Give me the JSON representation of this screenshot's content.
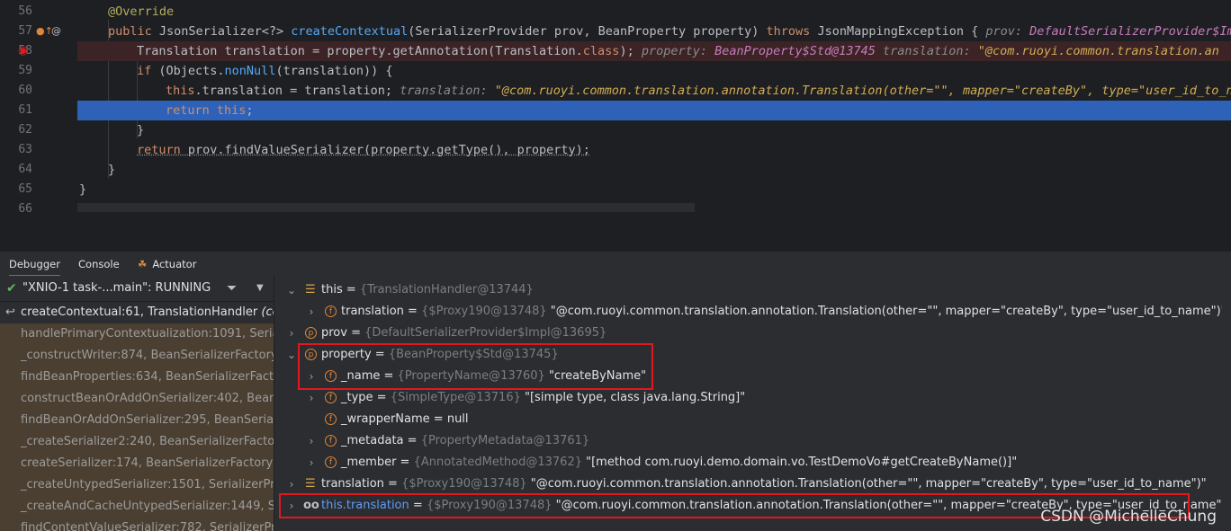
{
  "editor": {
    "lines": [
      {
        "no": "56",
        "tokens": [
          {
            "c": "ann",
            "t": "@Override"
          }
        ]
      },
      {
        "no": "57",
        "tokens": [
          {
            "c": "kw",
            "t": "public "
          },
          {
            "c": "ty",
            "t": "JsonSerializer<?> "
          },
          {
            "c": "fn",
            "t": "createContextual"
          },
          {
            "c": "ty",
            "t": "(SerializerProvider prov, BeanProperty property) "
          },
          {
            "c": "kw",
            "t": "throws "
          },
          {
            "c": "ty",
            "t": "JsonMappingException {   "
          },
          {
            "c": "hint",
            "t": "prov: "
          },
          {
            "c": "hintv",
            "t": "DefaultSerializerProvider$Impl"
          }
        ]
      },
      {
        "no": "58",
        "tokens": [
          {
            "c": "ty",
            "t": "Translation translation = property.getAnnotation(Translation."
          },
          {
            "c": "kw",
            "t": "class"
          },
          {
            "c": "ty",
            "t": ");   "
          },
          {
            "c": "hint",
            "t": "property: "
          },
          {
            "c": "hintv",
            "t": "BeanProperty$Std@13745    "
          },
          {
            "c": "hint",
            "t": "translation: "
          },
          {
            "c": "hintstr",
            "t": "\"@com.ruoyi.common.translation.an"
          }
        ]
      },
      {
        "no": "59",
        "tokens": [
          {
            "c": "kw",
            "t": "if "
          },
          {
            "c": "ty",
            "t": "(Objects."
          },
          {
            "c": "fn",
            "t": "nonNull"
          },
          {
            "c": "ty",
            "t": "(translation)) {"
          }
        ]
      },
      {
        "no": "60",
        "tokens": [
          {
            "c": "kw",
            "t": "this"
          },
          {
            "c": "ty",
            "t": ".translation = translation;   "
          },
          {
            "c": "hint",
            "t": "translation: "
          },
          {
            "c": "hintstr",
            "t": "\"@com.ruoyi.common.translation.annotation.Translation(other=\"\", mapper=\"createBy\", type=\"user_id_to_na"
          }
        ]
      },
      {
        "no": "61",
        "tokens": [
          {
            "c": "kw",
            "t": "return "
          },
          {
            "c": "kw",
            "t": "this"
          },
          {
            "c": "ty",
            "t": ";"
          }
        ]
      },
      {
        "no": "62",
        "tokens": [
          {
            "c": "ty",
            "t": "}"
          }
        ]
      },
      {
        "no": "63",
        "tokens": [
          {
            "c": "kw",
            "t": "return "
          },
          {
            "c": "ty",
            "t": "prov.findValueSerializer(property.getType(), property);"
          }
        ]
      },
      {
        "no": "64",
        "tokens": [
          {
            "c": "ty",
            "t": "}"
          }
        ]
      },
      {
        "no": "65",
        "tokens": [
          {
            "c": "ty",
            "t": "}"
          }
        ]
      },
      {
        "no": "66",
        "tokens": []
      }
    ]
  },
  "tabs": {
    "debugger": "Debugger",
    "console": "Console",
    "actuator": "Actuator"
  },
  "thread": {
    "label": "\"XNIO-1 task-...main\": RUNNING"
  },
  "frames": [
    {
      "method": "createContextual:61, ",
      "cls": "TranslationHandler",
      "suffix": " (com"
    },
    {
      "method": "handlePrimaryContextualization:1091, ",
      "cls": "Serializ",
      "suffix": ""
    },
    {
      "method": "_constructWriter:874, ",
      "cls": "BeanSerializerFactory",
      "suffix": " (c"
    },
    {
      "method": "findBeanProperties:634, ",
      "cls": "BeanSerializerFactory",
      "suffix": ""
    },
    {
      "method": "constructBeanOrAddOnSerializer:402, ",
      "cls": "BeanSe",
      "suffix": ""
    },
    {
      "method": "findBeanOrAddOnSerializer:295, ",
      "cls": "BeanSerialize",
      "suffix": ""
    },
    {
      "method": "_createSerializer2:240, ",
      "cls": "BeanSerializerFactory",
      "suffix": " (c"
    },
    {
      "method": "createSerializer:174, ",
      "cls": "BeanSerializerFactory",
      "suffix": " (co"
    },
    {
      "method": "_createUntypedSerializer:1501, ",
      "cls": "SerializerProvic",
      "suffix": ""
    },
    {
      "method": "_createAndCacheUntypedSerializer:1449, ",
      "cls": "Seria",
      "suffix": ""
    },
    {
      "method": "findContentValueSerializer:782, ",
      "cls": "SerializerProvi",
      "suffix": ""
    }
  ],
  "variables": [
    {
      "name": "this",
      "ref": "{TranslationHandler@13744}",
      "value": ""
    },
    {
      "name": "translation",
      "ref": "{$Proxy190@13748}",
      "value": "\"@com.ruoyi.common.translation.annotation.Translation(other=\"\", mapper=\"createBy\", type=\"user_id_to_name\")\""
    },
    {
      "name": "prov",
      "ref": "{DefaultSerializerProvider$Impl@13695}",
      "value": ""
    },
    {
      "name": "property",
      "ref": "{BeanProperty$Std@13745}",
      "value": ""
    },
    {
      "name": "_name",
      "ref": "{PropertyName@13760}",
      "value": "\"createByName\""
    },
    {
      "name": "_type",
      "ref": "{SimpleType@13716}",
      "value": "\"[simple type, class java.lang.String]\""
    },
    {
      "name": "_wrapperName",
      "ref": "",
      "value": "null"
    },
    {
      "name": "_metadata",
      "ref": "{PropertyMetadata@13761}",
      "value": ""
    },
    {
      "name": "_member",
      "ref": "{AnnotatedMethod@13762}",
      "value": "\"[method com.ruoyi.demo.domain.vo.TestDemoVo#getCreateByName()]\""
    },
    {
      "name": "translation",
      "ref": "{$Proxy190@13748}",
      "value": "\"@com.ruoyi.common.translation.annotation.Translation(other=\"\", mapper=\"createBy\", type=\"user_id_to_name\")\""
    },
    {
      "name": "this.translation",
      "ref": "{$Proxy190@13748}",
      "value": "\"@com.ruoyi.common.translation.annotation.Translation(other=\"\", mapper=\"createBy\", type=\"user_id_to_name\")\""
    }
  ],
  "watermark": "CSDN @MichelleChung",
  "colors": {
    "highlight_box": "#e1191f",
    "current_line": "#2e62b8",
    "breakpoint_line": "#3b2326"
  }
}
